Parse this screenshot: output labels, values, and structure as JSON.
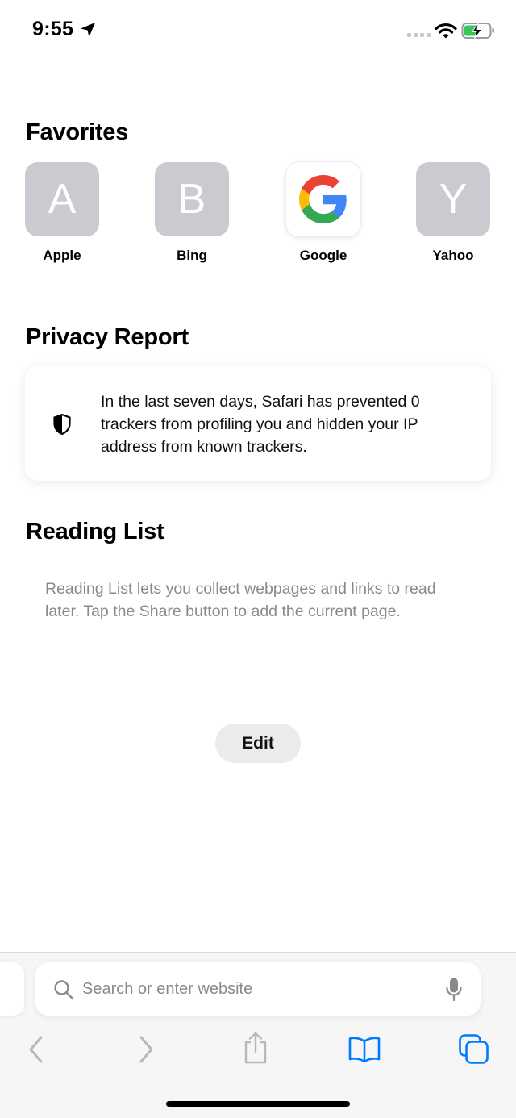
{
  "status_bar": {
    "time": "9:55",
    "icons": [
      "location-arrow-icon",
      "cellular-signal-icon",
      "wifi-icon",
      "battery-charging-icon"
    ],
    "battery_color": "#34c759"
  },
  "favorites": {
    "title": "Favorites",
    "items": [
      {
        "letter": "A",
        "label": "Apple"
      },
      {
        "letter": "B",
        "label": "Bing"
      },
      {
        "letter": "",
        "label": "Google",
        "icon": "google-logo-icon"
      },
      {
        "letter": "Y",
        "label": "Yahoo"
      }
    ]
  },
  "privacy": {
    "title": "Privacy Report",
    "text": "In the last seven days, Safari has prevented 0 trackers from profiling you and hidden your IP address from known trackers.",
    "icon": "shield-icon"
  },
  "reading_list": {
    "title": "Reading List",
    "description": "Reading List lets you collect webpages and links to read later. Tap the Share button to add the current page."
  },
  "edit_label": "Edit",
  "search": {
    "placeholder": "Search or enter website",
    "icons": [
      "search-icon",
      "microphone-icon"
    ]
  },
  "toolbar": {
    "icons": [
      "back-chevron-icon",
      "forward-chevron-icon",
      "share-icon",
      "bookmarks-book-icon",
      "tabs-icon"
    ],
    "accent_color": "#007aff",
    "disabled_color": "#b8b8bc"
  }
}
